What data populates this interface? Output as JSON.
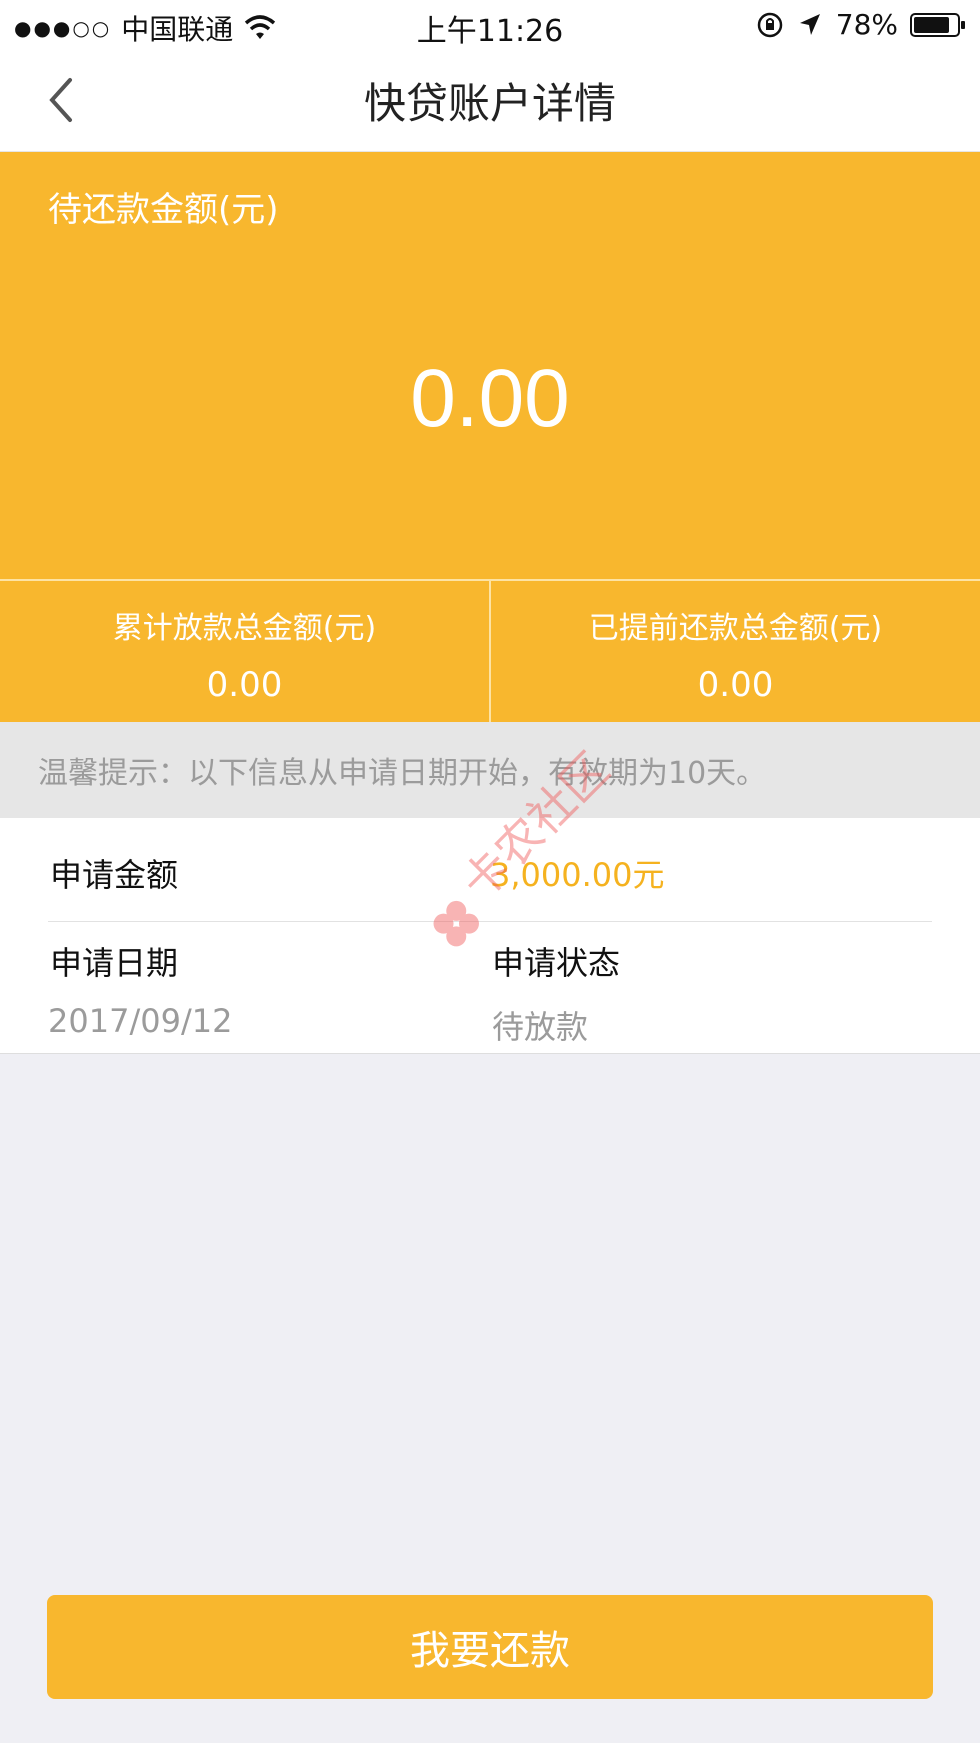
{
  "status_bar": {
    "signal": "●●●○○",
    "carrier": "中国联通",
    "time": "上午11:26",
    "battery": "78%"
  },
  "nav": {
    "title": "快贷账户详情",
    "back_icon": "chevron-left-icon"
  },
  "summary": {
    "pending_label": "待还款金额(元)",
    "pending_amount": "0.00",
    "loaned_label": "累计放款总金额(元)",
    "loaned_value": "0.00",
    "prepaid_label": "已提前还款总金额(元)",
    "prepaid_value": "0.00"
  },
  "tip": "温馨提示：以下信息从申请日期开始，有效期为10天。",
  "details": {
    "amount_label": "申请金额",
    "amount_value": "3,000.00元",
    "date_label": "申请日期",
    "date_value": "2017/09/12",
    "status_label": "申请状态",
    "status_value": "待放款"
  },
  "watermark_text": "卡农社区",
  "action": {
    "repay_label": "我要还款"
  },
  "colors": {
    "accent": "#f8b72e",
    "amount_text": "#f5b21f",
    "tip_bg": "#e6e6e6",
    "page_bg": "#efeff4"
  }
}
